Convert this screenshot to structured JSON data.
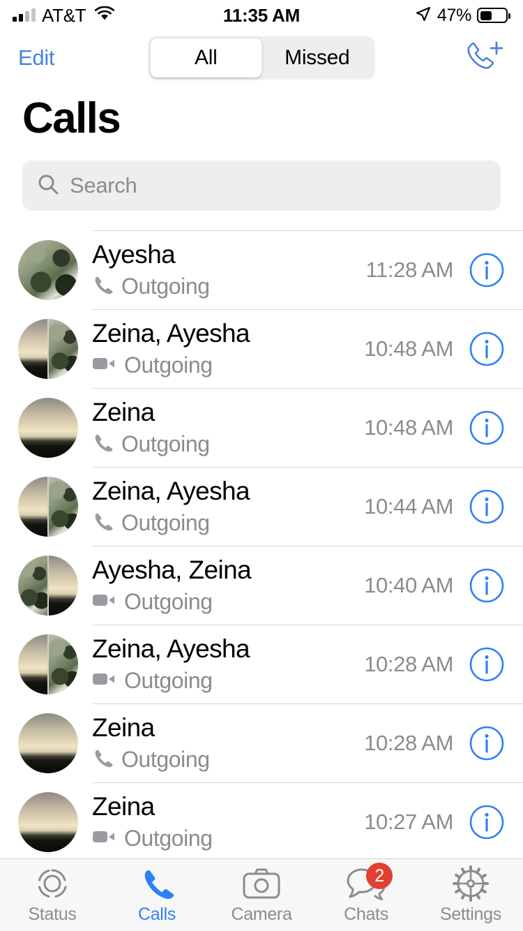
{
  "status_bar": {
    "carrier": "AT&T",
    "time": "11:35 AM",
    "battery_percent": "47%",
    "battery_level": 47,
    "signal_bars_filled": 2,
    "signal_bars_total": 4,
    "wifi_icon": "wifi-icon",
    "location_icon": "location-arrow-icon"
  },
  "nav": {
    "edit_label": "Edit",
    "new_call_icon": "phone-plus-icon",
    "segments": [
      {
        "label": "All",
        "active": true
      },
      {
        "label": "Missed",
        "active": false
      }
    ]
  },
  "page": {
    "title": "Calls"
  },
  "search": {
    "placeholder": "Search",
    "value": "",
    "icon": "search-icon"
  },
  "calls": [
    {
      "name": "Ayesha",
      "type": "Outgoing",
      "call_icon": "phone-icon",
      "time": "11:28 AM",
      "avatar": "foliage",
      "group": false
    },
    {
      "name": "Zeina, Ayesha",
      "type": "Outgoing",
      "call_icon": "video-icon",
      "time": "10:48 AM",
      "avatar": "sky|foliage",
      "group": true
    },
    {
      "name": "Zeina",
      "type": "Outgoing",
      "call_icon": "phone-icon",
      "time": "10:48 AM",
      "avatar": "sky",
      "group": false
    },
    {
      "name": "Zeina, Ayesha",
      "type": "Outgoing",
      "call_icon": "phone-icon",
      "time": "10:44 AM",
      "avatar": "sky|foliage",
      "group": true
    },
    {
      "name": "Ayesha, Zeina",
      "type": "Outgoing",
      "call_icon": "video-icon",
      "time": "10:40 AM",
      "avatar": "foliage|sky",
      "group": true
    },
    {
      "name": "Zeina, Ayesha",
      "type": "Outgoing",
      "call_icon": "video-icon",
      "time": "10:28 AM",
      "avatar": "sky|foliage",
      "group": true
    },
    {
      "name": "Zeina",
      "type": "Outgoing",
      "call_icon": "phone-icon",
      "time": "10:28 AM",
      "avatar": "sky",
      "group": false
    },
    {
      "name": "Zeina",
      "type": "Outgoing",
      "call_icon": "video-icon",
      "time": "10:27 AM",
      "avatar": "sky",
      "group": false
    }
  ],
  "info_icon": "info-circle-icon",
  "tabs": [
    {
      "label": "Status",
      "icon": "status-rings-icon",
      "active": false,
      "badge": ""
    },
    {
      "label": "Calls",
      "icon": "phone-icon",
      "active": true,
      "badge": ""
    },
    {
      "label": "Camera",
      "icon": "camera-icon",
      "active": false,
      "badge": ""
    },
    {
      "label": "Chats",
      "icon": "chat-bubbles-icon",
      "active": false,
      "badge": "2"
    },
    {
      "label": "Settings",
      "icon": "gear-icon",
      "active": false,
      "badge": ""
    }
  ],
  "colors": {
    "accent_blue": "#2e81f4",
    "edit_blue": "#4a82d8",
    "badge_red": "#e0402f",
    "secondary_gray": "#8b8b90",
    "field_gray": "#eeeeef"
  }
}
